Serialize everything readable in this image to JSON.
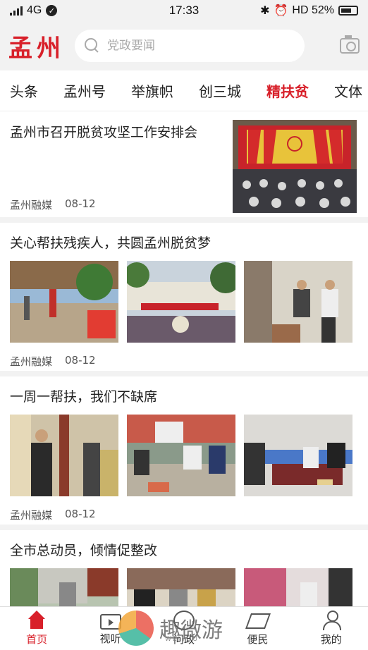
{
  "status_bar": {
    "carrier": "4G",
    "time": "17:33",
    "right_text": "HD 52%"
  },
  "header": {
    "logo": "孟州",
    "search_placeholder": "党政要闻"
  },
  "tabs": [
    {
      "label": "头条",
      "active": false
    },
    {
      "label": "孟州号",
      "active": false
    },
    {
      "label": "举旗帜",
      "active": false
    },
    {
      "label": "创三城",
      "active": false
    },
    {
      "label": "精扶贫",
      "active": true
    },
    {
      "label": "文体",
      "active": false
    }
  ],
  "articles": [
    {
      "title": "孟州市召开脱贫攻坚工作安排会",
      "source": "孟州融媒",
      "date": "08-12"
    },
    {
      "title": "关心帮扶残疾人，共圆孟州脱贫梦",
      "source": "孟州融媒",
      "date": "08-12"
    },
    {
      "title": "一周一帮扶，我们不缺席",
      "source": "孟州融媒",
      "date": "08-12"
    },
    {
      "title": "全市总动员，倾情促整改",
      "source": "",
      "date": ""
    }
  ],
  "tabbar": [
    {
      "label": "首页",
      "icon": "home-icon",
      "active": true
    },
    {
      "label": "视听",
      "icon": "tv-icon",
      "active": false
    },
    {
      "label": "问政",
      "icon": "ask-icon",
      "active": false
    },
    {
      "label": "便民",
      "icon": "send-icon",
      "active": false
    },
    {
      "label": "我的",
      "icon": "user-icon",
      "active": false
    }
  ],
  "watermark": {
    "text": "趣微游",
    "sub": "WEIYOU"
  },
  "colors": {
    "accent": "#d8202a",
    "background": "#f2f2f2"
  }
}
